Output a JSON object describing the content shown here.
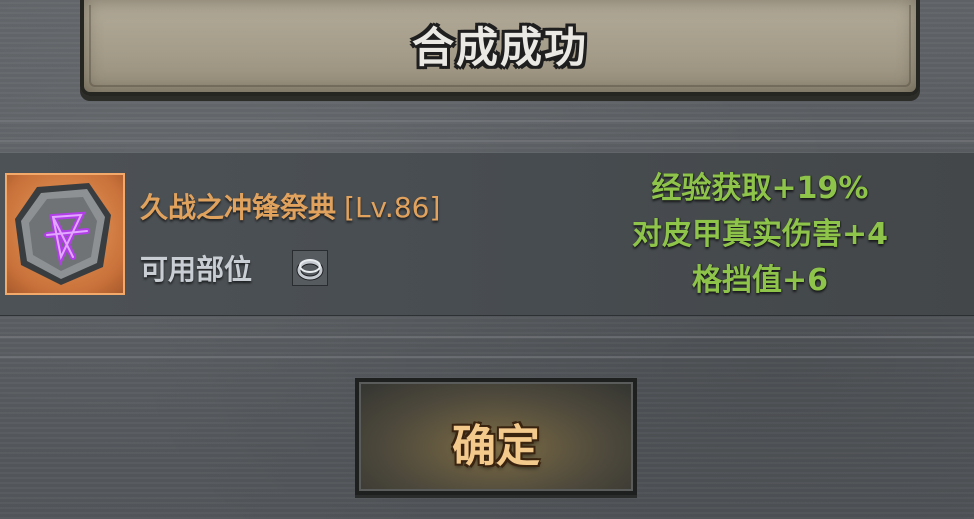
{
  "dialog": {
    "title": "合成成功"
  },
  "item": {
    "name": "久战之冲锋祭典",
    "level": "[Lv.86]",
    "slot_label": "可用部位",
    "icon": "rune-stone-icon",
    "slot_icon": "ring-icon",
    "rarity_color": "#e0874a"
  },
  "stats": [
    "经验获取+19%",
    "对皮甲真实伤害+4",
    "格挡值+6"
  ],
  "actions": {
    "confirm_label": "确定"
  },
  "colors": {
    "item_name": "#e1a25d",
    "stat_text": "#8fc44a",
    "rune_glow": "#b23ee8"
  }
}
